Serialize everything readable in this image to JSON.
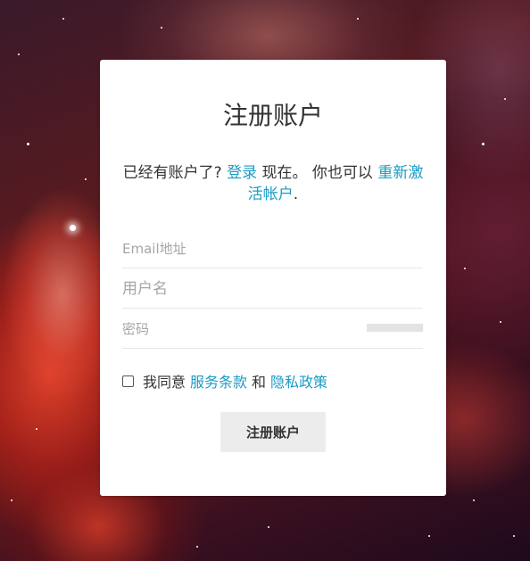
{
  "background": {
    "description_icon": "galaxy-nebula-background",
    "colors": [
      "#7a1c18",
      "#eb4630",
      "#3a1a2a"
    ]
  },
  "form": {
    "title": "注册账户",
    "info_prefix": "已经有账户了?",
    "login_link": "登录",
    "info_middle": "现在。 你也可以",
    "reactivate_link": "重新激活帐户",
    "info_suffix": ".",
    "email_placeholder": "Email地址",
    "email_value": "",
    "username_placeholder": "用户名",
    "username_value": "",
    "password_placeholder": "密码",
    "password_value": "",
    "agree_prefix": "我同意",
    "terms_link": "服务条款",
    "and_text": "和",
    "privacy_link": "隐私政策",
    "agree_checked": false,
    "submit_label": "注册账户"
  },
  "colors": {
    "link": "#1a9bc4",
    "button_bg": "#ececec",
    "text": "#333333"
  }
}
